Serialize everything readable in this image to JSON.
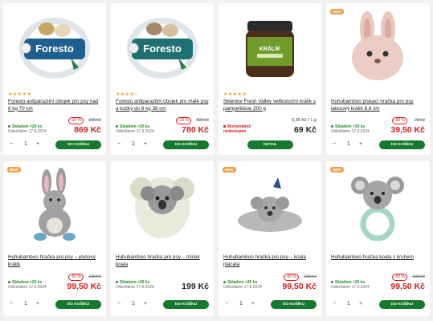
{
  "cards": [
    {
      "new": "",
      "rating": "★★★★★",
      "title": "Foresto antiparazitní obojek pro psy nad 8 kg 70 cm",
      "stock": "Skladem >20 ks",
      "delivery": "Odesíláme 17.9.2024",
      "discount": "-10 %",
      "old_price": "998 Kč",
      "unit_price": "",
      "price": "869 Kč",
      "qty": "1",
      "button": "DO KOŠÍKU"
    },
    {
      "new": "",
      "rating": "★★★★☆",
      "title": "Foresto antiparazitní obojek pro malé psy a kočky do 8 kg 38 cm",
      "stock": "Skladem >20 ks",
      "delivery": "Odesíláme 17.9.2024",
      "discount": "-10 %",
      "old_price": "899 Kč",
      "unit_price": "",
      "price": "780 Kč",
      "qty": "1",
      "button": "DO KOŠÍKU"
    },
    {
      "new": "",
      "rating": "★★★★★",
      "title": "Sklenice Fresh Valley velikonoční králík s pampeliškou 200 g",
      "stock": "Momentálně nedostupné",
      "delivery": "",
      "discount": "",
      "old_price": "",
      "unit_price": "0,35 Kč / 1 g",
      "price": "69 Kč",
      "qty": "",
      "button": "DETAIL"
    },
    {
      "new": "NEW",
      "rating": "",
      "title": "Huhubamboo pískací hračka pro psy latexový králík 8,8 cm",
      "stock": "Skladem >20 ks",
      "delivery": "Odesíláme 17.9.2024",
      "discount": "-50 %",
      "old_price": "79 Kč",
      "unit_price": "",
      "price": "39,50 Kč",
      "qty": "1",
      "button": "DO KOŠÍKU"
    },
    {
      "new": "NEW",
      "rating": "",
      "title": "Huhubamboo hračka pro psy – plyšový králík",
      "stock": "Skladem >20 ks",
      "delivery": "Odesíláme 17.9.2024",
      "discount": "-50 %",
      "old_price": "199 Kč",
      "unit_price": "",
      "price": "99,50 Kč",
      "qty": "1",
      "button": "DO KOŠÍKU"
    },
    {
      "new": "",
      "rating": "",
      "title": "Huhubamboo hračka pro psy – míček koala",
      "stock": "Skladem >20 ks",
      "delivery": "Odesíláme 17.9.2024",
      "discount": "",
      "old_price": "",
      "unit_price": "",
      "price": "199 Kč",
      "qty": "1",
      "button": "DO KOŠÍKU"
    },
    {
      "new": "NEW",
      "rating": "",
      "title": "Huhubamboo hračka pro psy – koala placatá",
      "stock": "Skladem >20 ks",
      "delivery": "Odesíláme 17.9.2024",
      "discount": "-50 %",
      "old_price": "199 Kč",
      "unit_price": "",
      "price": "99,50 Kč",
      "qty": "1",
      "button": "DO KOŠÍKU"
    },
    {
      "new": "NEW",
      "rating": "",
      "title": "Huhubamboo hračka koala s kruhem",
      "stock": "Skladem >20 ks",
      "delivery": "Odesíláme 17.9.2024",
      "discount": "-50 %",
      "old_price": "199 Kč",
      "unit_price": "",
      "price": "99,50 Kč",
      "qty": "1",
      "button": "DO KOŠÍKU"
    }
  ],
  "colors": {
    "accent_green": "#16792f",
    "sale_red": "#d21c1c",
    "new_badge": "#f0a04b",
    "rating": "#f39a2e"
  }
}
